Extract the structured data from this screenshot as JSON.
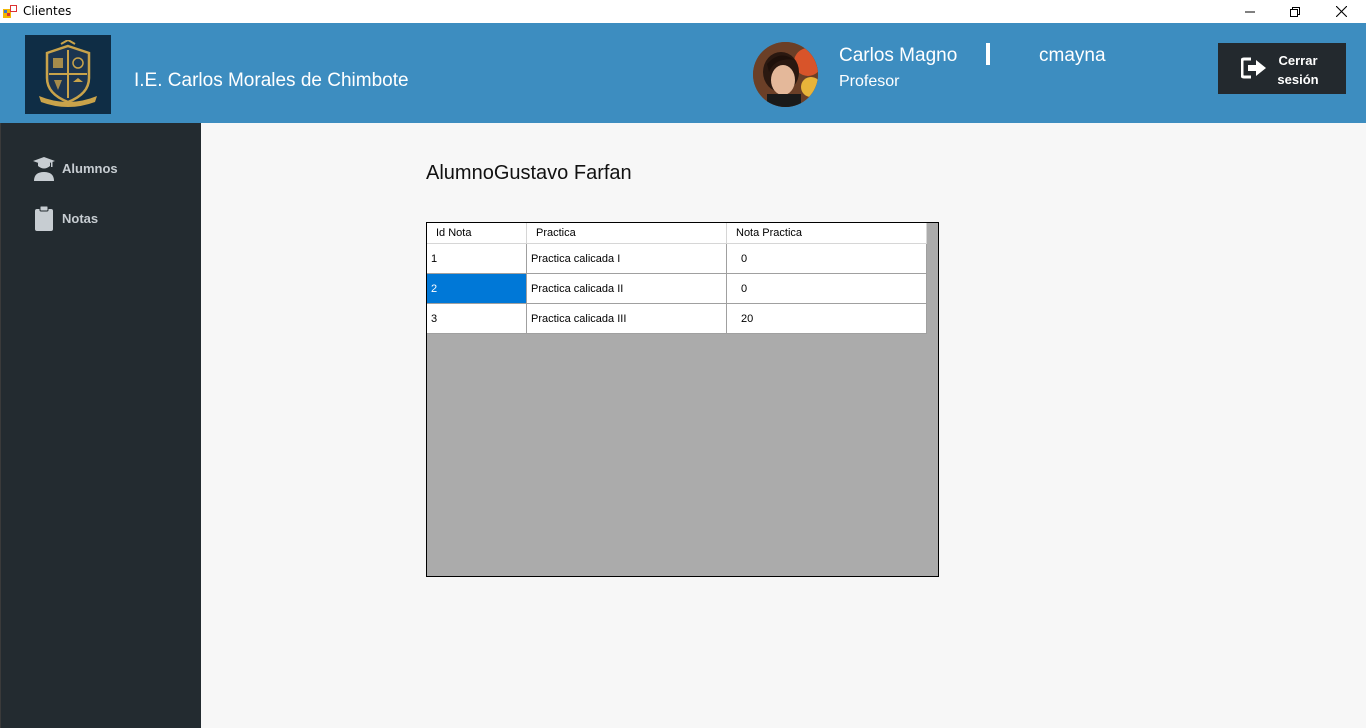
{
  "window": {
    "title": "Clientes",
    "controls": [
      "minimize-icon",
      "restore-icon",
      "close-icon"
    ]
  },
  "header": {
    "school_name": "I.E. Carlos Morales de Chimbote",
    "user_name": "Carlos Magno",
    "user_role": "Profesor",
    "username": "cmayna",
    "logout_label_line1": "Cerrar",
    "logout_label_line2": "sesión",
    "colors": {
      "header_bg": "#3d8dc0",
      "button_bg": "#23292e"
    }
  },
  "sidebar": {
    "items": [
      {
        "label": "Alumnos",
        "icon": "graduate-icon"
      },
      {
        "label": "Notas",
        "icon": "clipboard-icon"
      }
    ],
    "colors": {
      "bg": "#232b30",
      "text": "#c7cdd2"
    }
  },
  "main": {
    "student_title": "AlumnoGustavo Farfan",
    "grid": {
      "columns": [
        "Id Nota",
        "Practica",
        "Nota Practica"
      ],
      "rows": [
        {
          "id": "1",
          "practica": "Practica calicada I",
          "nota": "0"
        },
        {
          "id": "2",
          "practica": "Practica calicada II",
          "nota": "0"
        },
        {
          "id": "3",
          "practica": "Practica calicada III",
          "nota": "20"
        }
      ],
      "selected_cell": {
        "row": 2,
        "column": "Id Nota"
      },
      "colors": {
        "selection": "#0078d7",
        "empty_area": "#ababab"
      }
    }
  }
}
